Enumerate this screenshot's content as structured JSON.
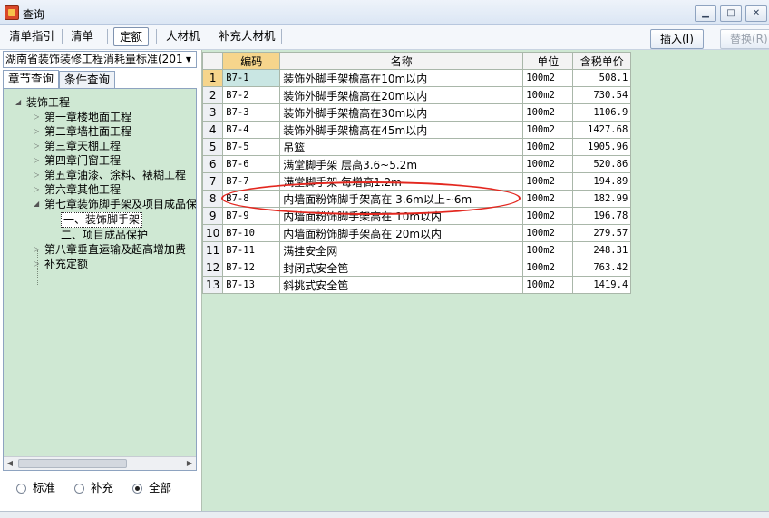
{
  "window": {
    "title": "查询",
    "controls": [
      "minimize",
      "maximize",
      "close"
    ]
  },
  "toolbar": {
    "tabs": [
      {
        "label": "清单指引",
        "active": false
      },
      {
        "label": "清单",
        "active": false
      },
      {
        "label": "定额",
        "active": true
      },
      {
        "label": "人材机",
        "active": false
      },
      {
        "label": "补充人材机",
        "active": false
      }
    ],
    "insert_label": "插入(I)",
    "replace_label": "替换(R)"
  },
  "left": {
    "standard_select": "湖南省装饰装修工程消耗量标准(201",
    "tabs": [
      {
        "label": "章节查询",
        "active": true
      },
      {
        "label": "条件查询",
        "active": false
      }
    ],
    "tree": [
      {
        "label": "装饰工程",
        "level": 0,
        "expanded": true
      },
      {
        "label": "第一章楼地面工程",
        "level": 1
      },
      {
        "label": "第二章墙柱面工程",
        "level": 1
      },
      {
        "label": "第三章天棚工程",
        "level": 1
      },
      {
        "label": "第四章门窗工程",
        "level": 1
      },
      {
        "label": "第五章油漆、涂料、裱糊工程",
        "level": 1
      },
      {
        "label": "第六章其他工程",
        "level": 1
      },
      {
        "label": "第七章装饰脚手架及项目成品保护",
        "level": 1,
        "expanded": true
      },
      {
        "label": "一、装饰脚手架",
        "level": 2,
        "selected": true
      },
      {
        "label": "二、项目成品保护",
        "level": 2
      },
      {
        "label": "第八章垂直运输及超高增加费",
        "level": 1
      },
      {
        "label": "补充定额",
        "level": 1
      }
    ],
    "radios": [
      {
        "label": "标准",
        "checked": false
      },
      {
        "label": "补充",
        "checked": false
      },
      {
        "label": "全部",
        "checked": true
      }
    ]
  },
  "grid": {
    "columns": [
      "编码",
      "名称",
      "单位",
      "含税单价"
    ],
    "current_row": 1,
    "rows": [
      {
        "no": "1",
        "code": "B7-1",
        "name": "装饰外脚手架檐高在10m以内",
        "unit": "100m2",
        "price": "508.1"
      },
      {
        "no": "2",
        "code": "B7-2",
        "name": "装饰外脚手架檐高在20m以内",
        "unit": "100m2",
        "price": "730.54"
      },
      {
        "no": "3",
        "code": "B7-3",
        "name": "装饰外脚手架檐高在30m以内",
        "unit": "100m2",
        "price": "1106.9"
      },
      {
        "no": "4",
        "code": "B7-4",
        "name": "装饰外脚手架檐高在45m以内",
        "unit": "100m2",
        "price": "1427.68"
      },
      {
        "no": "5",
        "code": "B7-5",
        "name": "吊篮",
        "unit": "100m2",
        "price": "1905.96"
      },
      {
        "no": "6",
        "code": "B7-6",
        "name": "满堂脚手架 层高3.6~5.2m",
        "unit": "100m2",
        "price": "520.86"
      },
      {
        "no": "7",
        "code": "B7-7",
        "name": "满堂脚手架 每增高1.2m",
        "unit": "100m2",
        "price": "194.89"
      },
      {
        "no": "8",
        "code": "B7-8",
        "name": "内墙面粉饰脚手架高在 3.6m以上~6m",
        "unit": "100m2",
        "price": "182.99"
      },
      {
        "no": "9",
        "code": "B7-9",
        "name": "内墙面粉饰脚手架高在 10m以内",
        "unit": "100m2",
        "price": "196.78"
      },
      {
        "no": "10",
        "code": "B7-10",
        "name": "内墙面粉饰脚手架高在 20m以内",
        "unit": "100m2",
        "price": "279.57"
      },
      {
        "no": "11",
        "code": "B7-11",
        "name": "满挂安全网",
        "unit": "100m2",
        "price": "248.31"
      },
      {
        "no": "12",
        "code": "B7-12",
        "name": "封闭式安全笆",
        "unit": "100m2",
        "price": "763.42"
      },
      {
        "no": "13",
        "code": "B7-13",
        "name": "斜挑式安全笆",
        "unit": "100m2",
        "price": "1419.4"
      }
    ]
  },
  "annotation": {
    "color": "#e3271f",
    "highlighted_row": "8"
  }
}
